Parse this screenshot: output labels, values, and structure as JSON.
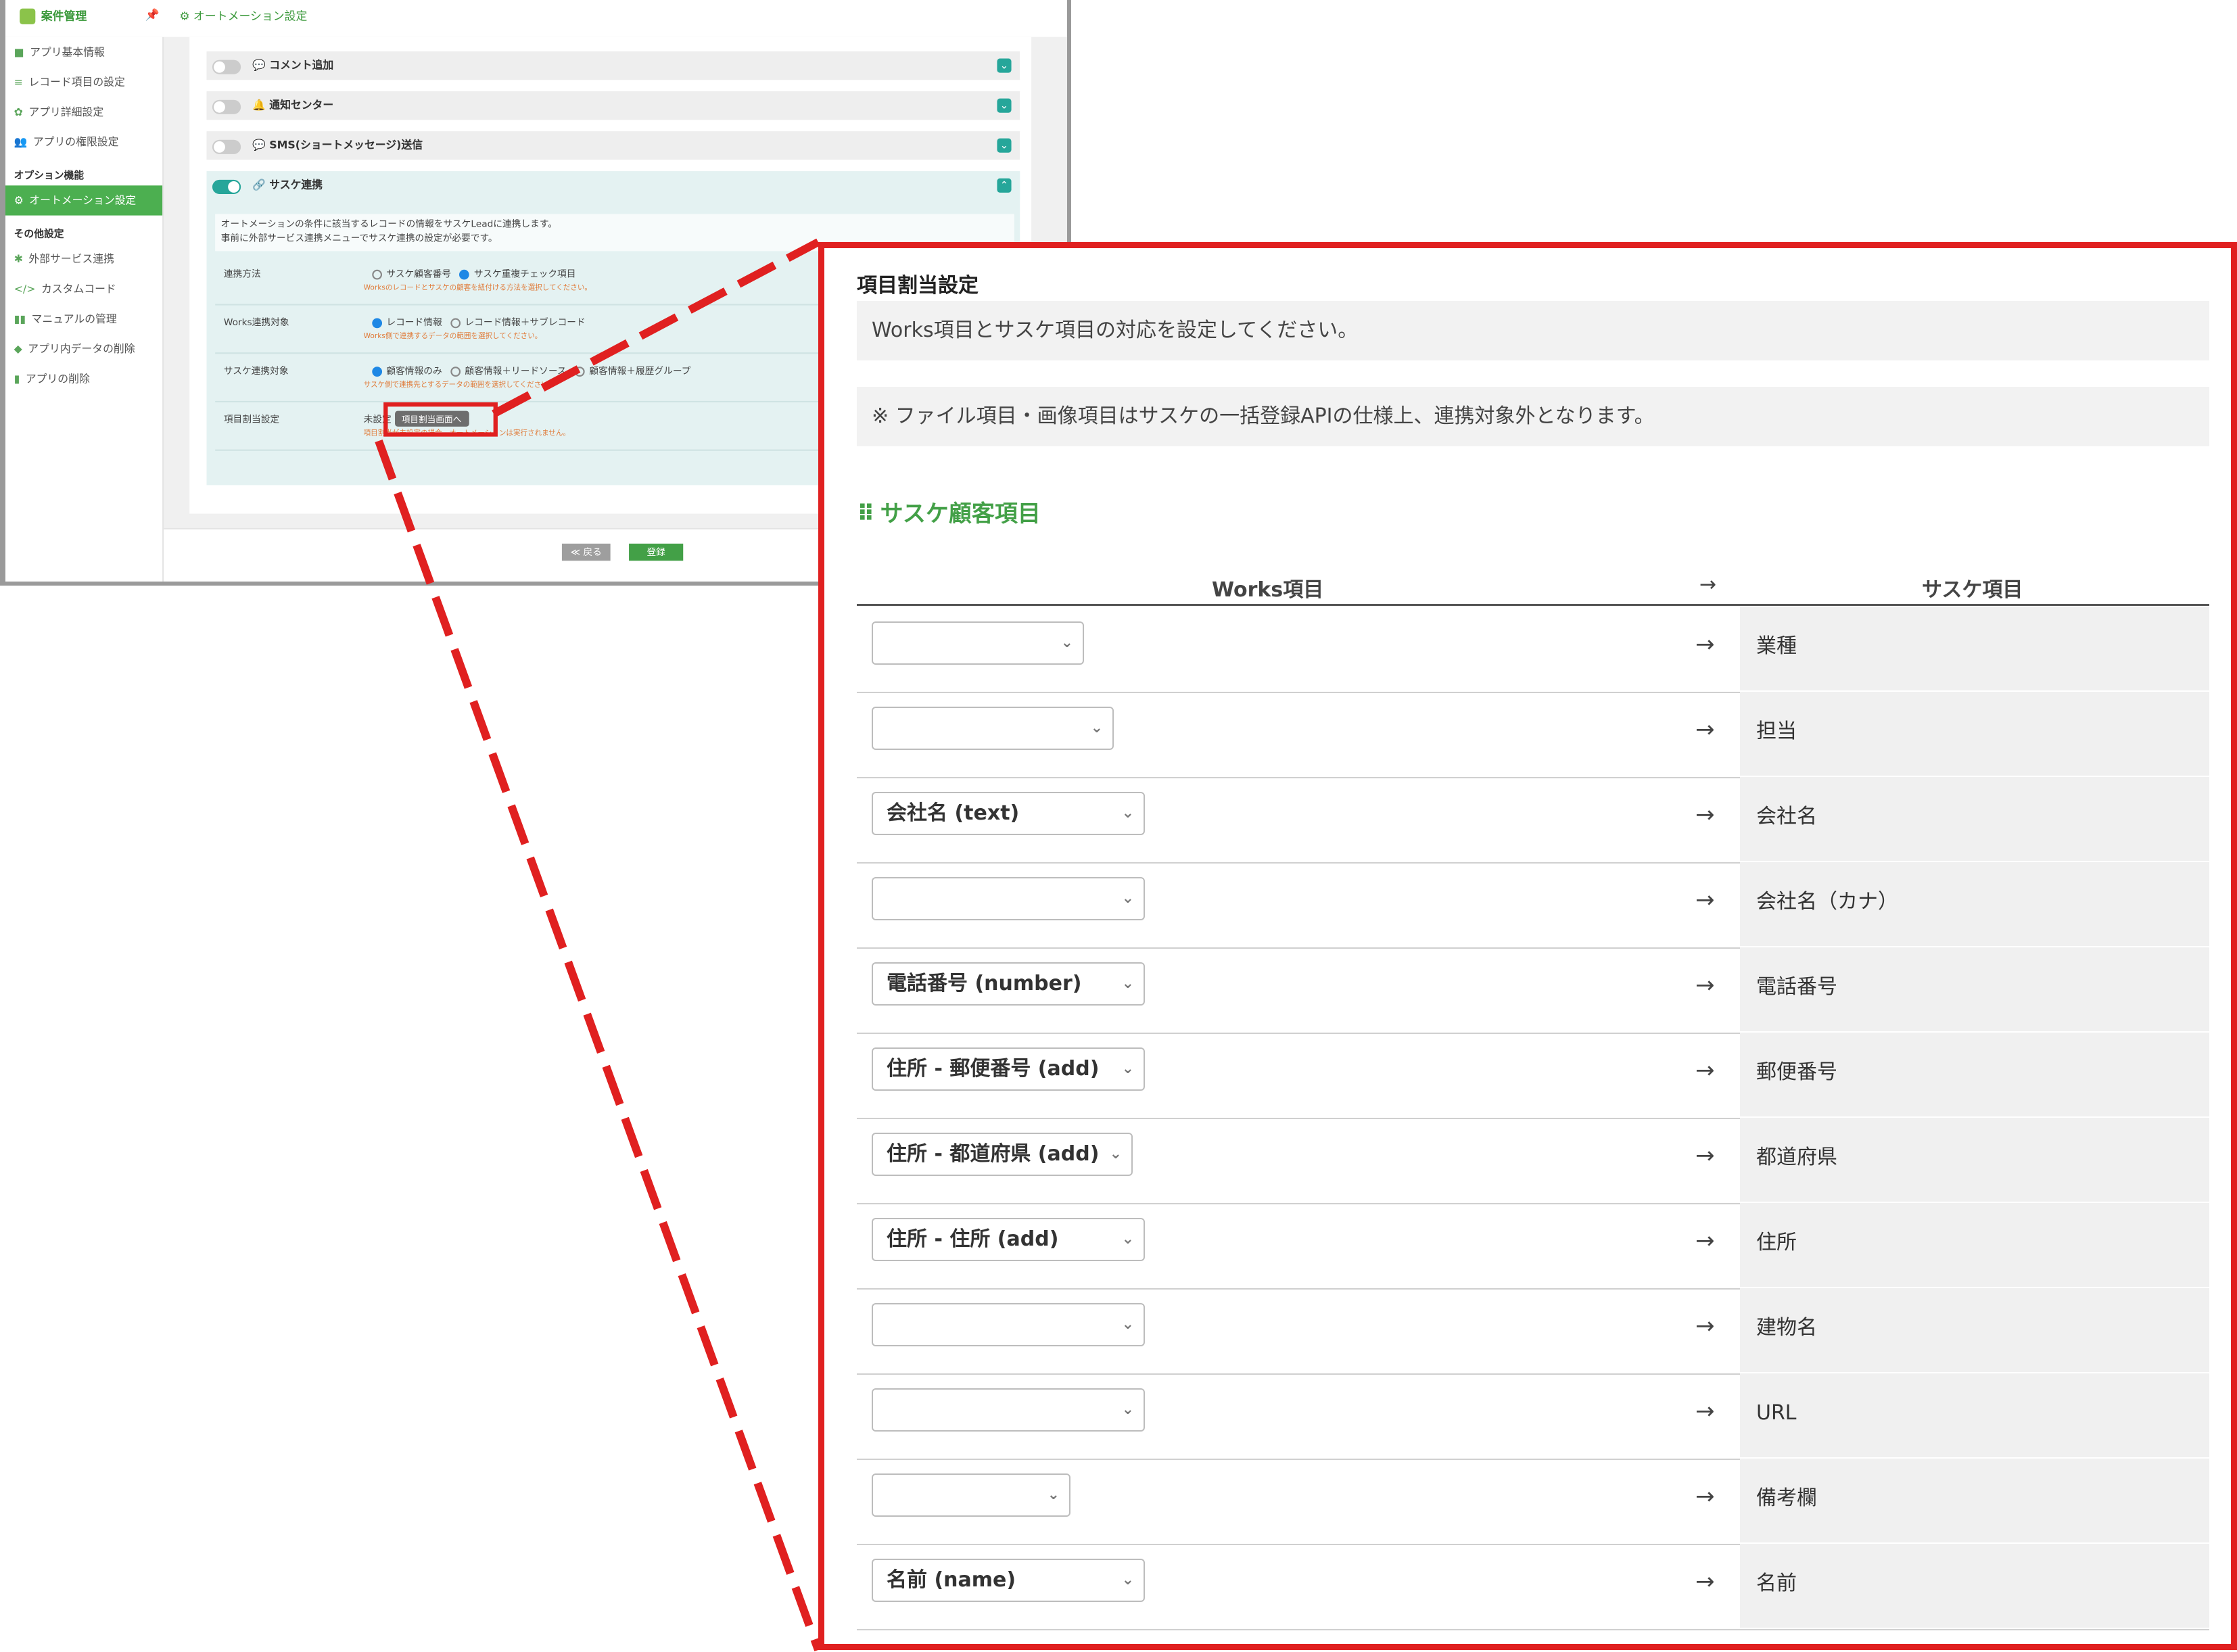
{
  "bg": {
    "app_title": "案件管理",
    "breadcrumb": "オートメーション設定",
    "sidebar": {
      "items": [
        "アプリ基本情報",
        "レコード項目の設定",
        "アプリ詳細設定",
        "アプリの権限設定"
      ],
      "option_header": "オプション機能",
      "option_items": [
        "オートメーション設定"
      ],
      "other_header": "その他設定",
      "other_items": [
        "外部サービス連携",
        "カスタムコード",
        "マニュアルの管理",
        "アプリ内データの削除",
        "アプリの削除"
      ]
    },
    "automations": [
      "コメント追加",
      "通知センター",
      "SMS(ショートメッセージ)送信",
      "サスケ連携"
    ],
    "sasuke": {
      "desc1": "オートメーションの条件に該当するレコードの情報をサスケLeadに連携します。",
      "desc2": "事前に外部サービス連携メニューでサスケ連携の設定が必要です。",
      "fields": [
        {
          "label": "連携方法",
          "opt1": "サスケ顧客番号",
          "opt2": "サスケ重複チェック項目",
          "opt3": "",
          "hint": "Worksのレコードとサスケの顧客を紐付ける方法を選択してください。"
        },
        {
          "label": "Works連携対象",
          "opt1": "レコード情報",
          "opt2": "レコード情報＋サブレコード",
          "opt3": "",
          "hint": "Works側で連携するデータの範囲を選択してください。"
        },
        {
          "label": "サスケ連携対象",
          "opt1": "顧客情報のみ",
          "opt2": "顧客情報＋リードソース",
          "opt3": "顧客情報＋履歴グループ",
          "hint": "サスケ側で連携先とするデータの範囲を選択してください。"
        }
      ],
      "mapping_label": "項目割当設定",
      "mapping_status": "未設定",
      "mapping_button": "項目割当画面へ",
      "mapping_hint": "項目割当が未設定の場合、オートメーションは実行されません。"
    },
    "back_button": "≪ 戻る",
    "save_button": "登録"
  },
  "zoom": {
    "title": "項目割当設定",
    "note1": "Works項目とサスケ項目の対応を設定してください。",
    "note2": "※ ファイル項目・画像項目はサスケの一括登録APIの仕様上、連携対象外となります。",
    "section": "サスケ顧客項目",
    "col_works": "Works項目",
    "col_arrow": "→",
    "col_sasuke": "サスケ項目",
    "rows": [
      {
        "works": "",
        "sasuke": "業種"
      },
      {
        "works": "",
        "sasuke": "担当"
      },
      {
        "works": "会社名 (text)",
        "sasuke": "会社名"
      },
      {
        "works": "",
        "sasuke": "会社名（カナ）"
      },
      {
        "works": "電話番号 (number)",
        "sasuke": "電話番号"
      },
      {
        "works": "住所 - 郵便番号 (add)",
        "sasuke": "郵便番号"
      },
      {
        "works": "住所 - 都道府県 (add)",
        "sasuke": "都道府県"
      },
      {
        "works": "住所 - 住所 (add)",
        "sasuke": "住所"
      },
      {
        "works": "",
        "sasuke": "建物名"
      },
      {
        "works": "",
        "sasuke": "URL"
      },
      {
        "works": "",
        "sasuke": "備考欄"
      },
      {
        "works": "名前 (name)",
        "sasuke": "名前"
      }
    ]
  },
  "colors": {
    "accent_green": "#43a047",
    "highlight_red": "#e02020",
    "toggle_on": "#26a69a"
  }
}
